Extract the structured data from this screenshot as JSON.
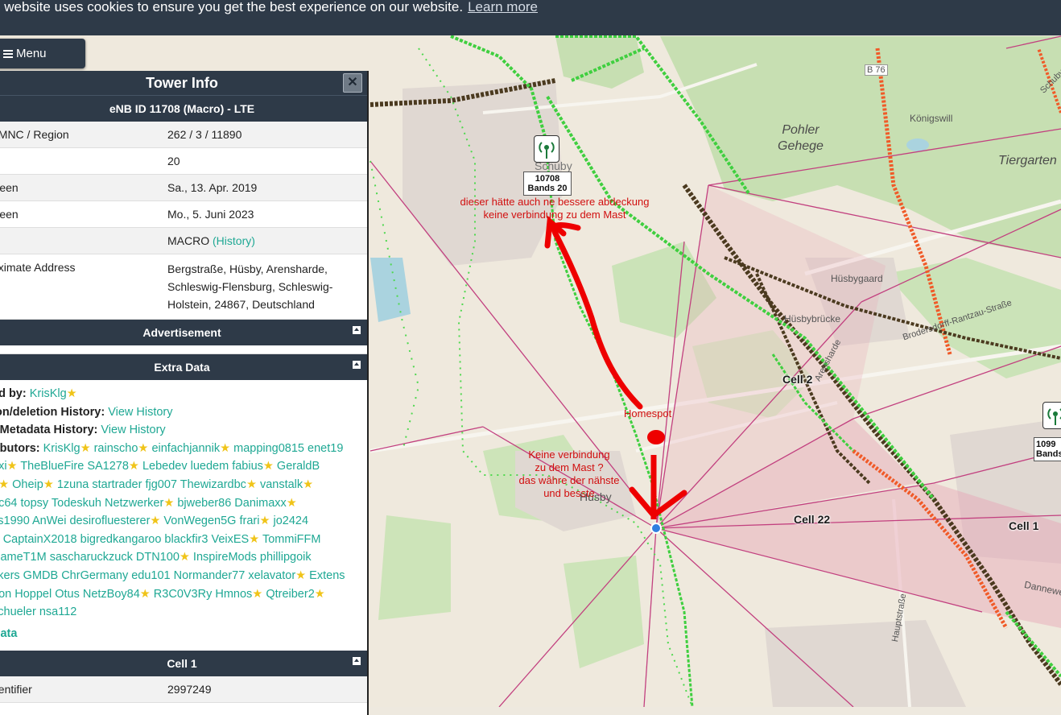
{
  "cookie": {
    "text": "s website uses cookies to ensure you get the best experience on our website.",
    "link": "Learn more"
  },
  "menu": {
    "label": "Menu"
  },
  "panel": {
    "title": "Tower Info",
    "subtitle": "eNB ID 11708 (Macro) - LTE",
    "rows": [
      {
        "key": "/ MNC / Region",
        "value": "262 / 3 / 11890"
      },
      {
        "key": "s",
        "value": "20"
      },
      {
        "key": "Seen",
        "value": "Sa., 13. Apr. 2019"
      },
      {
        "key": "Seen",
        "value": "Mo., 5. Juni 2023"
      },
      {
        "key": "",
        "value": "MACRO",
        "link": "(History)"
      },
      {
        "key": "oximate Address",
        "value": "Bergstraße, Hüsby, Arensharde, Schleswig-Flensburg, Schleswig-Holstein, 24867, Deutschland"
      }
    ],
    "advertisement": "Advertisement",
    "extra_title": "Extra Data",
    "extra": {
      "l1_label": "ed by:",
      "l1_link": "KrisKlg",
      "l2_label": "ion/deletion History:",
      "l2_link": "View History",
      "l3_label": "r Metadata History:",
      "l3_link": "View History",
      "l4_label": "ributors:",
      "contrib_lines": [
        "KrisKlg★ rainscho★ einfachjannik★ mapping0815 enet19",
        "uxi★ TheBlueFire SA1278★ Lebedev luedem fabius★ GeraldB",
        "7★ Oheip★ 1zuna startrader fjg007 Thewizardbc★ vanstalk★",
        "oc64 topsy Todeskuh Netzwerker★ bjweber86 Danimaxx★",
        "ss1990 AnWei desirofluesterer★ VonWegen5G frari★ jo2424",
        "K CaptainX2018 bigredkangaroo blackfir3 VeixES★ TommiFFM",
        "NameT1M sascharuckzuck DTN100★ InspireMods phillipgoik",
        "ckers GMDB ChrGermany edu101 Normander77 xelavator★ Extens",
        "eon Hoppel Otus NetzBoy84★ R3C0V3Ry Hmnos★ Qtreiber2★",
        "schueler nsa112"
      ],
      "data_link": "Data"
    },
    "cell_title": "Cell 1",
    "cell_row": {
      "key": "dentifier",
      "value": "2997249"
    }
  },
  "map": {
    "marker1": {
      "line1": "10708",
      "line2": "Bands 20"
    },
    "marker2": {
      "line1": "1099",
      "line2": "Bands"
    },
    "cells": {
      "c22": "Cell 22",
      "c1": "Cell 1",
      "c2": "Cell 2"
    },
    "places": {
      "pohler": "Pohler\nGehege",
      "tiergarten": "Tiergarten",
      "koenigswill": "Königswill",
      "huesbygaard": "Hüsbygaard",
      "huesbybruecke": "Hüsbybrücke",
      "huesby": "Hüsby",
      "schuby": "Schuby",
      "b76": "B 76",
      "arensharde": "Arensharde",
      "hauptstrasse": "Hauptstraße",
      "dannewerk": "Dannewe",
      "brodersdorff": "Brodersdorff-Rantzau-Straße",
      "schubyroad": "Schuby"
    },
    "annotations": {
      "top": "dieser hätte auch ne bessere abdeckung\nkeine verbindung zu dem Mast",
      "homespot": "Homespot",
      "bottom": "Keine verbindung\nzu dem Mast ?\ndas währe der nähste\nund besste"
    },
    "colors": {
      "accent": "#1fa894",
      "header": "#2e3a48",
      "annotation": "#d10f0f",
      "coverage_green": "#3fcf3f",
      "coverage_dark": "#4b3a1f",
      "coverage_orange": "#f05a28",
      "sector": "#c2407f"
    }
  }
}
